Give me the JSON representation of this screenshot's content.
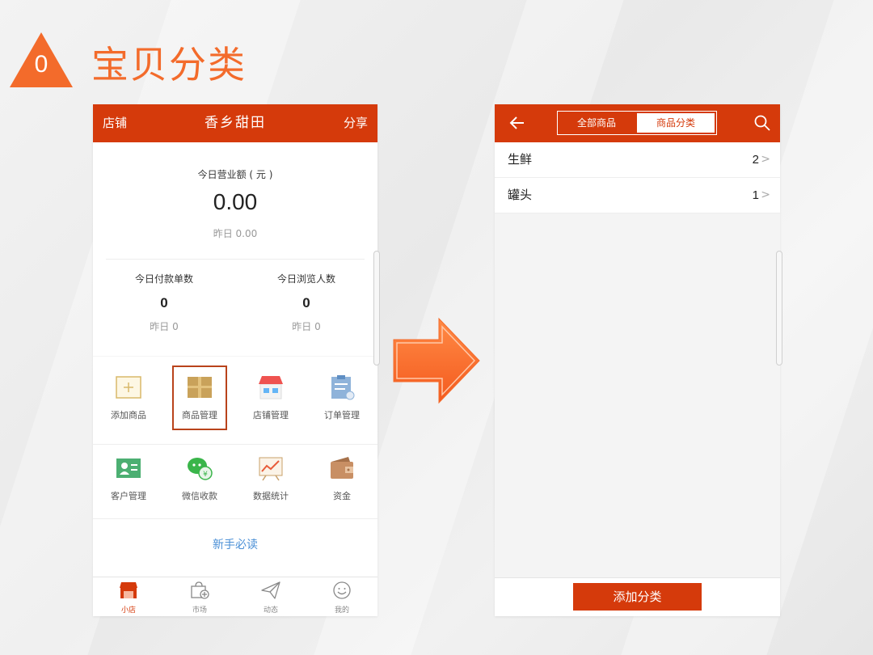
{
  "slide": {
    "step_number": "0",
    "title": "宝贝分类"
  },
  "colors": {
    "brand": "#d53a0b",
    "accent": "#f36b2b",
    "link": "#4a8fd6"
  },
  "left_phone": {
    "topbar": {
      "left": "店铺",
      "title": "香乡甜田",
      "right": "分享"
    },
    "sales": {
      "label": "今日营业额 ( 元 )",
      "value": "0.00",
      "yesterday": "昨日 0.00"
    },
    "orders": {
      "label": "今日付款单数",
      "value": "0",
      "yesterday": "昨日 0"
    },
    "visitors": {
      "label": "今日浏览人数",
      "value": "0",
      "yesterday": "昨日 0"
    },
    "grid": [
      {
        "label": "添加商品",
        "icon": "add-product-icon"
      },
      {
        "label": "商品管理",
        "icon": "box-icon"
      },
      {
        "label": "店铺管理",
        "icon": "store-icon"
      },
      {
        "label": "订单管理",
        "icon": "clipboard-icon"
      },
      {
        "label": "客户管理",
        "icon": "contact-card-icon"
      },
      {
        "label": "微信收款",
        "icon": "wechat-pay-icon"
      },
      {
        "label": "数据统计",
        "icon": "chart-icon"
      },
      {
        "label": "资金",
        "icon": "wallet-icon"
      }
    ],
    "guide_link": "新手必读",
    "tabs": [
      {
        "label": "小店",
        "icon": "store-icon",
        "active": true
      },
      {
        "label": "市场",
        "icon": "market-bag-icon",
        "active": false
      },
      {
        "label": "动态",
        "icon": "paper-plane-icon",
        "active": false
      },
      {
        "label": "我的",
        "icon": "smiley-icon",
        "active": false
      }
    ]
  },
  "right_phone": {
    "segments": {
      "all": "全部商品",
      "category": "商品分类"
    },
    "categories": [
      {
        "name": "生鲜",
        "count": "2"
      },
      {
        "name": "罐头",
        "count": "1"
      }
    ],
    "add_button": "添加分类"
  }
}
